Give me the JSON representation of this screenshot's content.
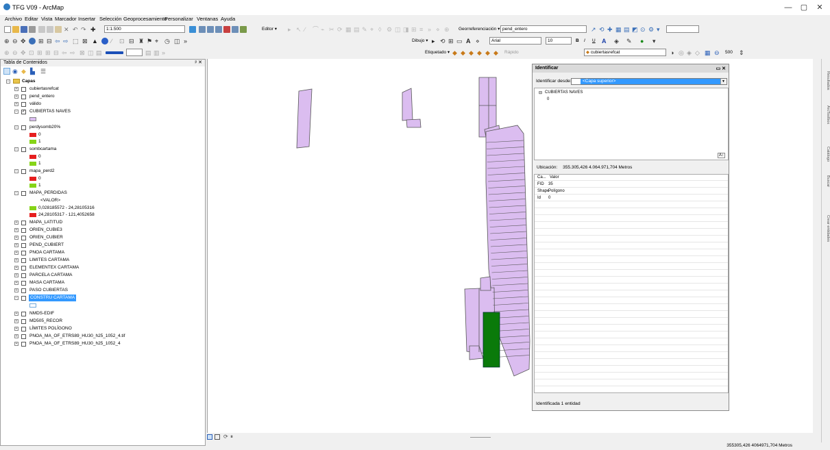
{
  "window": {
    "title": "TFG V09 - ArcMap",
    "min": "—",
    "max": "▢",
    "close": "✕"
  },
  "menu": [
    "Archivo",
    "Editar",
    "Vista",
    "Marcador",
    "Insertar",
    "Selección",
    "Geoprocesamiento",
    "Personalizar",
    "Ventanas",
    "Ayuda"
  ],
  "toolbar": {
    "scale": "1:1.500",
    "editor": "Editor ▾",
    "georef_label": "Georreferenciación ▾",
    "georef_layer": "pend_entero",
    "dibujo": "Dibujo ▾",
    "font": "Arial",
    "font_size": "10",
    "bold": "B",
    "italic": "I",
    "underline": "U",
    "etiquetado": "Etiquetado ▾",
    "rapido": "Rápido",
    "snap_layer": "cubiertasrefcat",
    "snap_value": "500"
  },
  "toc": {
    "title": "Tabla de Contenidos",
    "close": "ᵖ ✕",
    "root": "Capas",
    "layers": [
      {
        "name": "cubiertasrefcat",
        "checked": false,
        "expanded": false
      },
      {
        "name": "pend_entero",
        "checked": false,
        "expanded": false
      },
      {
        "name": "válido",
        "checked": false,
        "expanded": false
      },
      {
        "name": "CUBIERTAS NAVES",
        "checked": true,
        "expanded": true
      },
      {
        "name": "perdysomb20%",
        "checked": false,
        "expanded": true
      },
      {
        "name": "sombcartama",
        "checked": false,
        "expanded": true
      },
      {
        "name": "mapa_perd2",
        "checked": false,
        "expanded": true
      },
      {
        "name": "MAPA_PERDIDAS",
        "checked": false,
        "expanded": true
      },
      {
        "name": "MAPA_LATITUD",
        "checked": false,
        "expanded": false
      },
      {
        "name": "ORIEN_CUBIE3",
        "checked": false,
        "expanded": false
      },
      {
        "name": "ORIEN_CUBIER",
        "checked": false,
        "expanded": false
      },
      {
        "name": "PEND_CUBIERT",
        "checked": false,
        "expanded": false
      },
      {
        "name": "PNOA CARTAMA",
        "checked": false,
        "expanded": false
      },
      {
        "name": "LIMITES CARTAMA",
        "checked": false,
        "expanded": false
      },
      {
        "name": "ELEMENTEX CARTAMA",
        "checked": false,
        "expanded": false
      },
      {
        "name": "PARCELA CARTAMA",
        "checked": false,
        "expanded": false
      },
      {
        "name": "MASA CARTAMA",
        "checked": false,
        "expanded": false
      },
      {
        "name": "PASO CUBIERTAS",
        "checked": false,
        "expanded": false
      },
      {
        "name": "CONSTRU CARTAMA",
        "checked": false,
        "expanded": true,
        "selected": true
      },
      {
        "name": "NMDS-EDIF",
        "checked": false,
        "expanded": false
      },
      {
        "name": "MD505_RECOR",
        "checked": false,
        "expanded": false
      },
      {
        "name": "LÍMITES POLÍGONO",
        "checked": false,
        "expanded": false
      },
      {
        "name": "PNOA_MA_OF_ETRS89_HU30_h25_1052_4.tif",
        "checked": false,
        "expanded": false
      },
      {
        "name": "PNOA_MA_OF_ETRS89_HU30_h25_1052_4",
        "checked": false,
        "expanded": false
      }
    ],
    "legend": {
      "zero": "0",
      "one": "1",
      "valor": "<VALOR>",
      "range1": "0,028185572 - 24,28105316",
      "range2": "24,28105317 - 121,4052658"
    },
    "colors": {
      "purple": "#dbbdf0",
      "red": "#e61e1e",
      "green": "#86d418",
      "cyan_outline": "#6fa8dc",
      "selected": "#3399ff"
    }
  },
  "identify": {
    "title": "Identificar",
    "from_label": "Identificar desde:",
    "from_value": "<Capa superior>",
    "tree_layer": "CUBIERTAS NAVES",
    "tree_child": "0",
    "location_label": "Ubicación:",
    "location_value": "355.305,426  4.064.971,704 Metros",
    "table_header": [
      "Ca...",
      "Valor"
    ],
    "rows": [
      [
        "FID",
        "35"
      ],
      [
        "Shape",
        "Polígono"
      ],
      [
        "Id",
        "0"
      ]
    ],
    "status": "Identificada 1 entidad"
  },
  "sidepanel": [
    "Resultados",
    "ArcToolbox",
    "Catálogo",
    "Buscar",
    "Crear entidades"
  ],
  "statusbar": {
    "coords": "355305,426  4064971,704 Metros"
  },
  "map_colors": {
    "polygon_fill": "#dbbdf0",
    "polygon_stroke": "#555555",
    "highlight": "#0a7a0a"
  }
}
